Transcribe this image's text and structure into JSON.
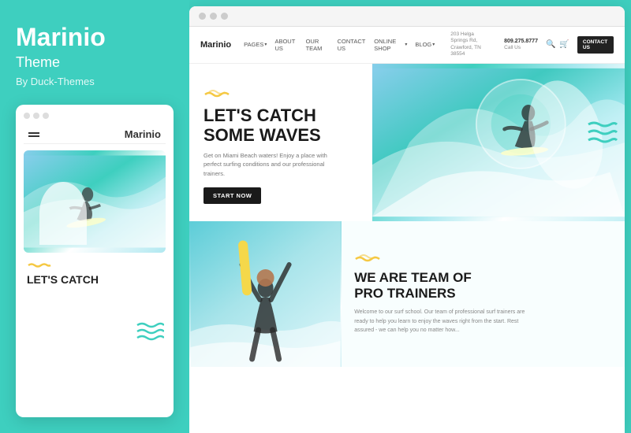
{
  "left": {
    "title": "Marinio",
    "subtitle": "Theme",
    "author": "By Duck-Themes",
    "mobile_logo": "Marinio",
    "mobile_headline": "LET'S CATCH",
    "yellow_wave": "≋≋",
    "wave_deco": "≋≋≋"
  },
  "browser": {
    "site_logo": "Marinio",
    "nav_items": [
      "PAGES",
      "ABOUT US",
      "OUR TEAM",
      "CONTACT US",
      "ONLINE SHOP",
      "BLOG"
    ],
    "address_line1": "203 Helga Springs Rd,",
    "address_line2": "Crawford, TN 38554",
    "phone": "809.275.8777",
    "phone_label": "Call Us",
    "contact_btn": "CONTACT US",
    "hero": {
      "yellow_wave": "≋≋",
      "title_line1": "LET'S CATCH",
      "title_line2": "SOME WAVES",
      "subtitle": "Get on Miami Beach waters! Enjoy a place with perfect surfing conditions and our professional trainers.",
      "cta_button": "START NOW"
    },
    "second": {
      "yellow_wave": "≋≋",
      "title_line1": "WE ARE TEAM OF",
      "title_line2": "PRO TRAINERS",
      "subtitle": "Welcome to our surf school. Our team of professional surf trainers are ready to help you learn to enjoy the waves right from the start. Rest assured - we can help you no matter how..."
    }
  },
  "colors": {
    "teal": "#3ecfbf",
    "yellow": "#f5c842",
    "dark": "#1a1a1a",
    "white": "#ffffff"
  }
}
